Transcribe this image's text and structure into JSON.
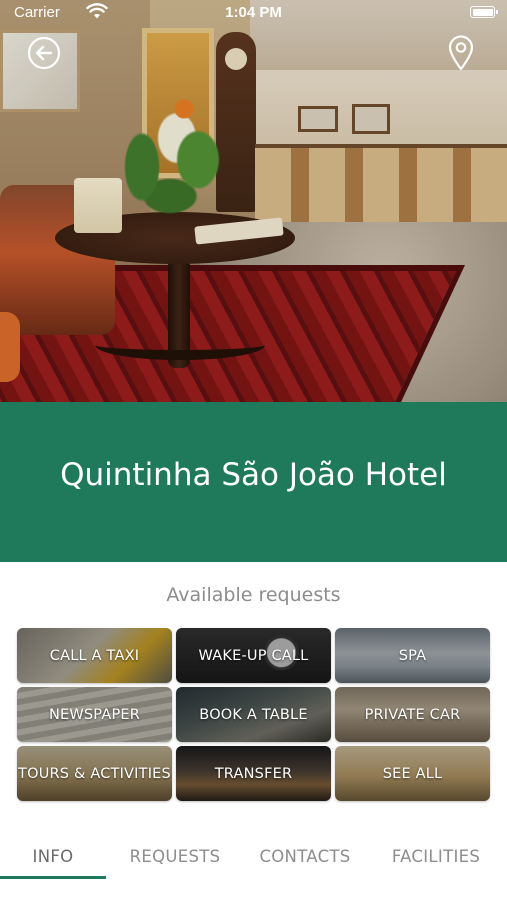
{
  "status_bar": {
    "carrier": "Carrier",
    "time": "1:04 PM",
    "wifi_icon": "wifi-icon",
    "battery_icon": "battery-icon"
  },
  "header": {
    "back_icon": "back-arrow-icon",
    "map_icon": "map-pin-icon"
  },
  "hotel": {
    "name": "Quintinha São João Hotel"
  },
  "requests": {
    "label": "Available requests",
    "items": [
      {
        "label": "CALL A TAXI"
      },
      {
        "label": "WAKE-UP CALL"
      },
      {
        "label": "SPA"
      },
      {
        "label": "NEWSPAPER"
      },
      {
        "label": "BOOK A TABLE"
      },
      {
        "label": "PRIVATE CAR"
      },
      {
        "label": "TOURS & ACTIVITIES"
      },
      {
        "label": "TRANSFER"
      },
      {
        "label": "SEE ALL"
      }
    ]
  },
  "tabs": {
    "active": "INFO",
    "items": [
      {
        "label": "INFO"
      },
      {
        "label": "REQUESTS"
      },
      {
        "label": "CONTACTS"
      },
      {
        "label": "FACILITIES"
      }
    ]
  },
  "colors": {
    "brand_green": "#1f7a5c",
    "text_gray": "#8d8d8d"
  }
}
